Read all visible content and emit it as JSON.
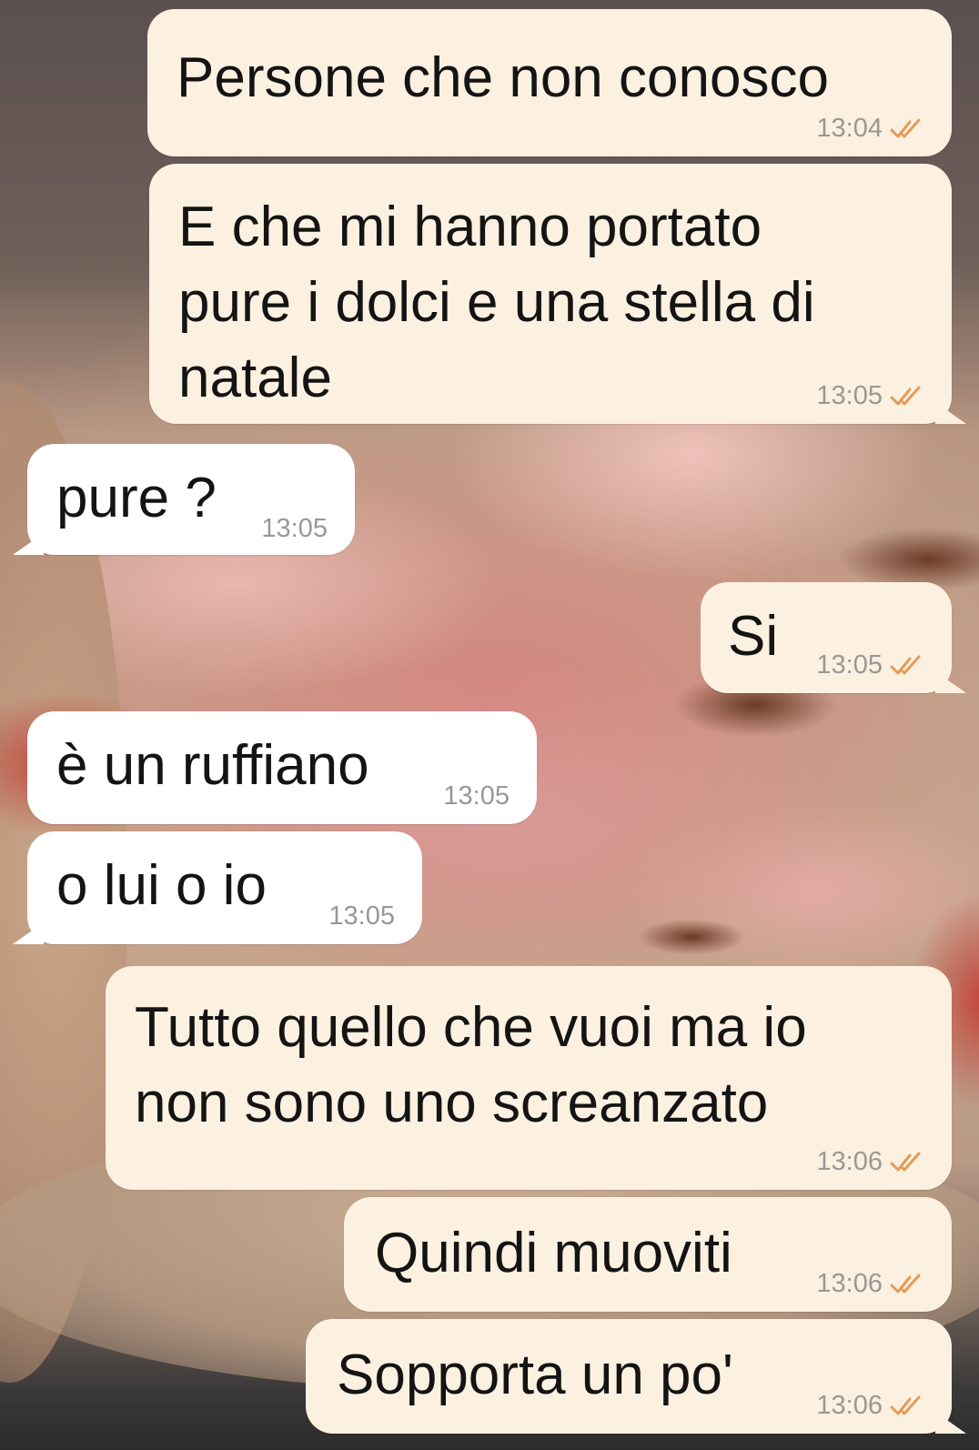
{
  "colors": {
    "outgoing_bubble": "#fcf1e0",
    "incoming_bubble": "#ffffff",
    "timestamp": "#9a9894",
    "read_ticks": "#e39b5b"
  },
  "messages": [
    {
      "direction": "outgoing",
      "text": "Persone che non conosco",
      "time": "13:04",
      "status_icon": "double-check-icon"
    },
    {
      "direction": "outgoing",
      "text": "E che mi hanno portato\npure i dolci e una stella di\nnatale",
      "time": "13:05",
      "status_icon": "double-check-icon"
    },
    {
      "direction": "incoming",
      "text": "pure ?",
      "time": "13:05"
    },
    {
      "direction": "outgoing",
      "text": "Si",
      "time": "13:05",
      "status_icon": "double-check-icon"
    },
    {
      "direction": "incoming",
      "text": "è un ruffiano",
      "time": "13:05"
    },
    {
      "direction": "incoming",
      "text": "o lui o io",
      "time": "13:05"
    },
    {
      "direction": "outgoing",
      "text": "Tutto quello che vuoi ma io\nnon sono uno screanzato",
      "time": "13:06",
      "status_icon": "double-check-icon"
    },
    {
      "direction": "outgoing",
      "text": "Quindi muoviti",
      "time": "13:06",
      "status_icon": "double-check-icon"
    },
    {
      "direction": "outgoing",
      "text": "Sopporta un po'",
      "time": "13:06",
      "status_icon": "double-check-icon"
    }
  ]
}
